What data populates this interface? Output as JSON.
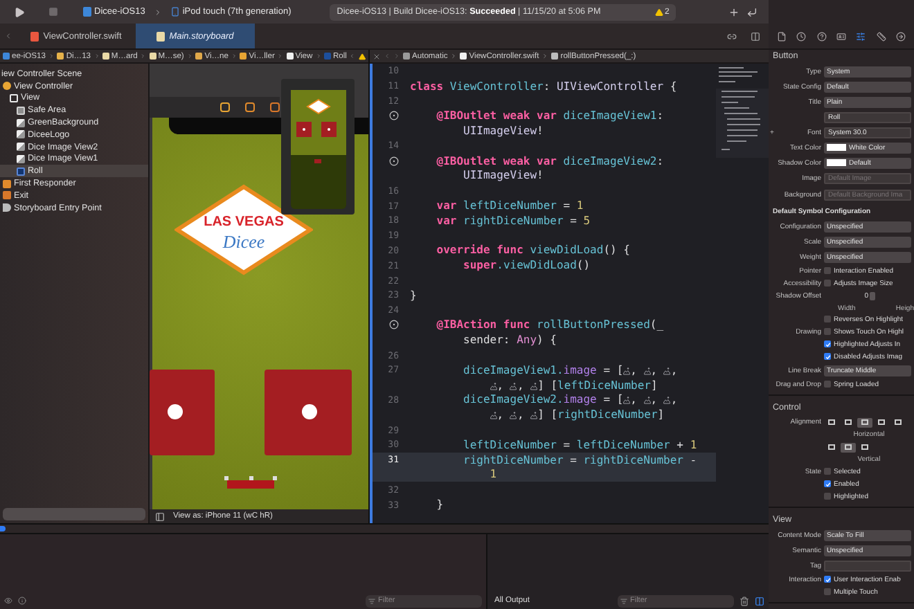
{
  "toolbar": {
    "scheme": "Dicee-iOS13",
    "device": "iPod touch (7th generation)",
    "status": "Dicee-iOS13 | Build Dicee-iOS13: **Succeeded** | 11/15/20 at 5:06 PM",
    "warnings": "2"
  },
  "tabs": [
    {
      "label": "ViewController.swift",
      "kind": "swift",
      "selected": false
    },
    {
      "label": "Main.storyboard",
      "kind": "storyboard",
      "selected": true
    }
  ],
  "inspector_tabs": [
    {
      "kind": "file",
      "selected": false
    },
    {
      "kind": "history",
      "selected": false
    },
    {
      "kind": "help",
      "selected": false
    },
    {
      "kind": "identity",
      "selected": false
    },
    {
      "kind": "attributes",
      "selected": true
    },
    {
      "kind": "size",
      "selected": false
    },
    {
      "kind": "connections",
      "selected": false
    }
  ],
  "storyboard_breadcrumb": [
    {
      "kind": "project",
      "label": "ee-iOS13"
    },
    {
      "kind": "folder",
      "label": "Di…13"
    },
    {
      "kind": "file",
      "label": "M…ard"
    },
    {
      "kind": "file",
      "label": "M…se)"
    },
    {
      "kind": "scene",
      "label": "Vi…ne"
    },
    {
      "kind": "vc",
      "label": "Vi…ller"
    },
    {
      "kind": "view",
      "label": "View"
    },
    {
      "kind": "button",
      "label": "Roll"
    }
  ],
  "code_breadcrumb": [
    {
      "kind": "automatic",
      "label": "Automatic"
    },
    {
      "kind": "swift",
      "label": "ViewController.swift"
    },
    {
      "kind": "method",
      "label": "rollButtonPressed(_:)"
    }
  ],
  "outline": {
    "items": [
      {
        "label": "iew Controller Scene",
        "selected": false,
        "children": [
          {
            "label": "View Controller",
            "kind": "vc",
            "selected": false,
            "children": [
              {
                "label": "View",
                "kind": "view",
                "selected": false,
                "children": [
                  {
                    "label": "Safe Area",
                    "kind": "safearea",
                    "selected": false
                  },
                  {
                    "label": "GreenBackground",
                    "kind": "image",
                    "selected": false
                  },
                  {
                    "label": "DiceeLogo",
                    "kind": "image",
                    "selected": false
                  },
                  {
                    "label": "Dice Image View2",
                    "kind": "image",
                    "selected": false
                  },
                  {
                    "label": "Dice Image View1",
                    "kind": "image",
                    "selected": false
                  },
                  {
                    "label": "Roll",
                    "kind": "button",
                    "selected": true
                  }
                ]
              }
            ]
          },
          {
            "label": "First Responder",
            "kind": "responder",
            "selected": false
          },
          {
            "label": "Exit",
            "kind": "exit",
            "selected": false
          },
          {
            "label": "Storyboard Entry Point",
            "kind": "entry",
            "selected": false
          }
        ]
      }
    ]
  },
  "canvas": {
    "logo_title": "LAS VEGAS",
    "logo_script": "Dicee",
    "view_as": "View as: iPhone 11 (wC hR)"
  },
  "editor": {
    "lines": [
      {
        "number": "10",
        "current": false
      },
      {
        "number": "11",
        "current": false,
        "tokens": [
          {
            "kind": "kw",
            "text": "class "
          },
          {
            "kind": "name",
            "text": "ViewController"
          },
          {
            "kind": "plain",
            "text": ": "
          },
          {
            "kind": "type",
            "text": "UIViewController"
          },
          {
            "kind": "plain",
            "text": " {"
          }
        ]
      },
      {
        "number": "12",
        "current": false
      },
      {
        "outlet": true,
        "current": false,
        "tokens": [
          {
            "kind": "kw",
            "text": "    @IBOutlet weak var "
          },
          {
            "kind": "name",
            "text": "diceImageView1"
          },
          {
            "kind": "plain",
            "text": ":"
          }
        ],
        "wrap": [
          {
            "kind": "type",
            "text": "UIImageView"
          },
          {
            "kind": "plain",
            "text": "!"
          }
        ]
      },
      {
        "number": "14",
        "current": false
      },
      {
        "outlet": true,
        "current": false,
        "tokens": [
          {
            "kind": "kw",
            "text": "    @IBOutlet weak var "
          },
          {
            "kind": "name",
            "text": "diceImageView2"
          },
          {
            "kind": "plain",
            "text": ":"
          }
        ],
        "wrap": [
          {
            "kind": "type",
            "text": "UIImageView"
          },
          {
            "kind": "plain",
            "text": "!"
          }
        ]
      },
      {
        "number": "16",
        "current": false
      },
      {
        "number": "17",
        "current": false,
        "tokens": [
          {
            "kind": "kw",
            "text": "    var "
          },
          {
            "kind": "name",
            "text": "leftDiceNumber"
          },
          {
            "kind": "plain",
            "text": " = "
          },
          {
            "kind": "num",
            "text": "1"
          }
        ]
      },
      {
        "number": "18",
        "current": false,
        "tokens": [
          {
            "kind": "kw",
            "text": "    var "
          },
          {
            "kind": "name",
            "text": "rightDiceNumber"
          },
          {
            "kind": "plain",
            "text": " = "
          },
          {
            "kind": "num",
            "text": "5"
          }
        ]
      },
      {
        "number": "19",
        "current": false
      },
      {
        "number": "20",
        "current": false,
        "tokens": [
          {
            "kind": "kw",
            "text": "    override func "
          },
          {
            "kind": "name",
            "text": "viewDidLoad"
          },
          {
            "kind": "plain",
            "text": "() {"
          }
        ]
      },
      {
        "number": "21",
        "current": false,
        "tokens": [
          {
            "kind": "kw",
            "text": "        super"
          },
          {
            "kind": "name",
            "text": ".viewDidLoad"
          },
          {
            "kind": "plain",
            "text": "()"
          }
        ]
      },
      {
        "number": "22",
        "current": false
      },
      {
        "number": "23",
        "current": false,
        "tokens": [
          {
            "kind": "plain",
            "text": "}"
          }
        ]
      },
      {
        "number": "24",
        "current": false
      },
      {
        "outlet": true,
        "current": false,
        "tokens": [
          {
            "kind": "kw",
            "text": "    @IBAction func "
          },
          {
            "kind": "name",
            "text": "rollButtonPressed"
          },
          {
            "kind": "plain",
            "text": "(_"
          }
        ],
        "wrap": [
          {
            "kind": "plain",
            "text": "sender: "
          },
          {
            "kind": "any",
            "text": "Any"
          },
          {
            "kind": "plain",
            "text": ") {"
          }
        ]
      },
      {
        "number": "26",
        "current": false
      },
      {
        "number": "27",
        "current": false,
        "tokens": [
          {
            "kind": "name",
            "text": "        diceImageView1."
          },
          {
            "kind": "prop",
            "text": "image"
          },
          {
            "kind": "plain",
            "text": " = ["
          },
          {
            "kind": "image"
          },
          {
            "kind": "plain",
            "text": ", "
          },
          {
            "kind": "image"
          },
          {
            "kind": "plain",
            "text": ", "
          },
          {
            "kind": "image"
          },
          {
            "kind": "plain",
            "text": ","
          }
        ],
        "wrap": [
          {
            "kind": "image"
          },
          {
            "kind": "plain",
            "text": ", "
          },
          {
            "kind": "image"
          },
          {
            "kind": "plain",
            "text": ", "
          },
          {
            "kind": "image"
          },
          {
            "kind": "plain",
            "text": "] ["
          },
          {
            "kind": "name",
            "text": "leftDiceNumber"
          },
          {
            "kind": "plain",
            "text": "]"
          }
        ]
      },
      {
        "number": "28",
        "current": false,
        "tokens": [
          {
            "kind": "name",
            "text": "        diceImageView2."
          },
          {
            "kind": "prop",
            "text": "image"
          },
          {
            "kind": "plain",
            "text": " = ["
          },
          {
            "kind": "image"
          },
          {
            "kind": "plain",
            "text": ", "
          },
          {
            "kind": "image"
          },
          {
            "kind": "plain",
            "text": ", "
          },
          {
            "kind": "image"
          },
          {
            "kind": "plain",
            "text": ","
          }
        ],
        "wrap": [
          {
            "kind": "image"
          },
          {
            "kind": "plain",
            "text": ", "
          },
          {
            "kind": "image"
          },
          {
            "kind": "plain",
            "text": ", "
          },
          {
            "kind": "image"
          },
          {
            "kind": "plain",
            "text": "] ["
          },
          {
            "kind": "name",
            "text": "rightDiceNumber"
          },
          {
            "kind": "plain",
            "text": "]"
          }
        ]
      },
      {
        "number": "29",
        "current": false
      },
      {
        "number": "30",
        "current": false,
        "tokens": [
          {
            "kind": "name",
            "text": "        leftDiceNumber"
          },
          {
            "kind": "plain",
            "text": " = "
          },
          {
            "kind": "name",
            "text": "leftDiceNumber"
          },
          {
            "kind": "plain",
            "text": " + "
          },
          {
            "kind": "num",
            "text": "1"
          }
        ]
      },
      {
        "number": "31",
        "current": true,
        "tokens": [
          {
            "kind": "name",
            "text": "        rightDiceNumber"
          },
          {
            "kind": "plain",
            "text": " = "
          },
          {
            "kind": "name",
            "text": "rightDiceNumber"
          },
          {
            "kind": "plain",
            "text": " -"
          }
        ],
        "wrap": [
          {
            "kind": "num",
            "text": "1"
          }
        ]
      },
      {
        "number": "32",
        "current": false
      },
      {
        "number": "33",
        "current": false,
        "tokens": [
          {
            "kind": "plain",
            "text": "    }"
          }
        ]
      }
    ]
  },
  "inspector": {
    "sections": [
      {
        "title": "Button",
        "rows": [
          {
            "kind": "popup",
            "label": "Type",
            "value": "System"
          },
          {
            "kind": "popup",
            "label": "State Config",
            "value": "Default"
          },
          {
            "kind": "popup",
            "label": "Title",
            "value": "Plain"
          },
          {
            "kind": "field",
            "value": "Roll"
          },
          {
            "kind": "field",
            "prefix": "+",
            "label": "Font",
            "value": "System 30.0"
          },
          {
            "kind": "color",
            "label": "Text Color",
            "value": "White Color"
          },
          {
            "kind": "color",
            "label": "Shadow Color",
            "value": "Default"
          },
          {
            "kind": "image_well",
            "label": "Image",
            "placeholder": "Default Image"
          },
          {
            "kind": "image_well",
            "label": "Background",
            "placeholder": "Default Background Ima"
          },
          {
            "kind": "subheader",
            "label": "Default Symbol Configuration"
          },
          {
            "kind": "popup",
            "label": "Configuration",
            "value": "Unspecified"
          },
          {
            "kind": "popup",
            "label": "Scale",
            "value": "Unspecified"
          },
          {
            "kind": "popup",
            "label": "Weight",
            "value": "Unspecified"
          },
          {
            "kind": "check",
            "label": "Pointer",
            "text": "Interaction Enabled",
            "checked": false
          },
          {
            "kind": "check",
            "label": "Accessibility",
            "text": "Adjusts Image Size",
            "checked": false
          },
          {
            "kind": "offset",
            "label": "Shadow Offset",
            "value": "0"
          },
          {
            "kind": "captions",
            "items": [
              "Width",
              "Heigh"
            ]
          },
          {
            "kind": "check",
            "text": "Reverses On Highlight",
            "checked": false
          },
          {
            "kind": "check",
            "label": "Drawing",
            "text": "Shows Touch On Highl",
            "checked": false
          },
          {
            "kind": "check",
            "text": "Highlighted Adjusts In",
            "checked": true
          },
          {
            "kind": "check",
            "text": "Disabled Adjusts Imag",
            "checked": true
          },
          {
            "kind": "popup",
            "label": "Line Break",
            "value": "Truncate Middle"
          },
          {
            "kind": "check",
            "label": "Drag and Drop",
            "text": "Spring Loaded",
            "checked": false
          }
        ]
      },
      {
        "title": "Control",
        "rows": [
          {
            "kind": "segments",
            "label": "Alignment",
            "caption": "Horizontal",
            "items": [
              {
                "selected": false
              },
              {
                "selected": false
              },
              {
                "selected": true
              },
              {
                "selected": false
              },
              {
                "selected": false
              }
            ]
          },
          {
            "kind": "segments",
            "caption": "Vertical",
            "items": [
              {
                "selected": false
              },
              {
                "selected": true
              },
              {
                "selected": false
              }
            ]
          },
          {
            "kind": "check",
            "label": "State",
            "text": "Selected",
            "checked": false
          },
          {
            "kind": "check",
            "text": "Enabled",
            "checked": true
          },
          {
            "kind": "check",
            "text": "Highlighted",
            "checked": false
          }
        ]
      },
      {
        "title": "View",
        "rows": [
          {
            "kind": "popup",
            "label": "Content Mode",
            "value": "Scale To Fill"
          },
          {
            "kind": "popup",
            "label": "Semantic",
            "value": "Unspecified"
          },
          {
            "kind": "field",
            "label": "Tag"
          },
          {
            "kind": "check",
            "label": "Interaction",
            "text": "User Interaction Enab",
            "checked": true
          },
          {
            "kind": "check",
            "text": "Multiple Touch",
            "checked": false
          }
        ]
      }
    ]
  },
  "debug": {
    "variables_filter": "Filter",
    "output": "All Output",
    "console_filter": "Filter"
  }
}
